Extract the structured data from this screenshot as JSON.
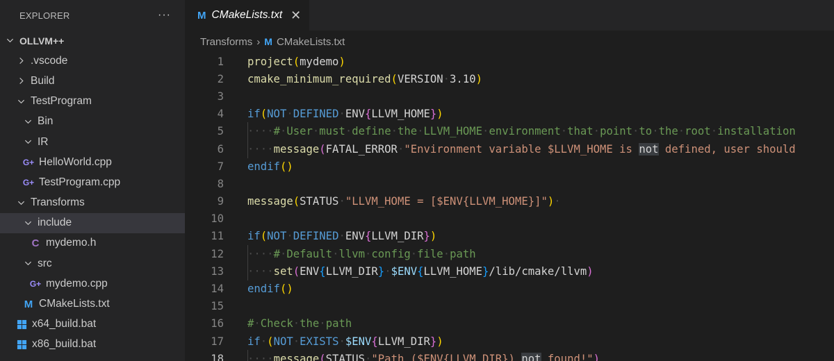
{
  "explorer": {
    "title": "EXPLORER",
    "more_label": "···",
    "tree": [
      {
        "label": "OLLVM++",
        "level": 0,
        "kind": "folder",
        "state": "open",
        "root": true
      },
      {
        "label": ".vscode",
        "level": 1,
        "kind": "folder",
        "state": "closed"
      },
      {
        "label": "Build",
        "level": 1,
        "kind": "folder",
        "state": "closed"
      },
      {
        "label": "TestProgram",
        "level": 1,
        "kind": "folder",
        "state": "open"
      },
      {
        "label": "Bin",
        "level": 2,
        "kind": "folder",
        "state": "open"
      },
      {
        "label": "IR",
        "level": 2,
        "kind": "folder",
        "state": "open"
      },
      {
        "label": "HelloWorld.cpp",
        "level": 2,
        "kind": "cpp"
      },
      {
        "label": "TestProgram.cpp",
        "level": 2,
        "kind": "cpp"
      },
      {
        "label": "Transforms",
        "level": 1,
        "kind": "folder",
        "state": "open"
      },
      {
        "label": "include",
        "level": 2,
        "kind": "folder",
        "state": "open",
        "selected": true
      },
      {
        "label": "mydemo.h",
        "level": 3,
        "kind": "h"
      },
      {
        "label": "src",
        "level": 2,
        "kind": "folder",
        "state": "open"
      },
      {
        "label": "mydemo.cpp",
        "level": 3,
        "kind": "cpp"
      },
      {
        "label": "CMakeLists.txt",
        "level": 2,
        "kind": "cmake"
      },
      {
        "label": "x64_build.bat",
        "level": 1,
        "kind": "bat"
      },
      {
        "label": "x86_build.bat",
        "level": 1,
        "kind": "bat"
      }
    ]
  },
  "tab": {
    "icon_glyph": "M",
    "label": "CMakeLists.txt",
    "close_glyph": "✕"
  },
  "breadcrumb": {
    "folder": "Transforms",
    "separator": "›",
    "icon_glyph": "M",
    "file": "CMakeLists.txt"
  },
  "editor": {
    "current_line": 18,
    "lines": [
      {
        "n": 1,
        "tokens": [
          [
            "fn",
            "project"
          ],
          [
            "p1",
            "("
          ],
          [
            "tx",
            "mydemo"
          ],
          [
            "p1",
            ")"
          ]
        ]
      },
      {
        "n": 2,
        "tokens": [
          [
            "fn",
            "cmake_minimum_required"
          ],
          [
            "p1",
            "("
          ],
          [
            "tx",
            "VERSION"
          ],
          [
            "ws",
            "·"
          ],
          [
            "tx",
            "3.10"
          ],
          [
            "p1",
            ")"
          ]
        ]
      },
      {
        "n": 3,
        "tokens": []
      },
      {
        "n": 4,
        "tokens": [
          [
            "kw",
            "if"
          ],
          [
            "p1",
            "("
          ],
          [
            "kw",
            "NOT"
          ],
          [
            "ws",
            "·"
          ],
          [
            "kw",
            "DEFINED"
          ],
          [
            "ws",
            "·"
          ],
          [
            "tx",
            "ENV"
          ],
          [
            "p2",
            "{"
          ],
          [
            "tx",
            "LLVM_HOME"
          ],
          [
            "p2",
            "}"
          ],
          [
            "p1",
            ")"
          ]
        ]
      },
      {
        "n": 5,
        "guide": true,
        "tokens": [
          [
            "ws",
            "····"
          ],
          [
            "cm",
            "#"
          ],
          [
            "ws",
            "·"
          ],
          [
            "cm",
            "User"
          ],
          [
            "ws",
            "·"
          ],
          [
            "cm",
            "must"
          ],
          [
            "ws",
            "·"
          ],
          [
            "cm",
            "define"
          ],
          [
            "ws",
            "·"
          ],
          [
            "cm",
            "the"
          ],
          [
            "ws",
            "·"
          ],
          [
            "cm",
            "LLVM_HOME"
          ],
          [
            "ws",
            "·"
          ],
          [
            "cm",
            "environment"
          ],
          [
            "ws",
            "·"
          ],
          [
            "cm",
            "that"
          ],
          [
            "ws",
            "·"
          ],
          [
            "cm",
            "point"
          ],
          [
            "ws",
            "·"
          ],
          [
            "cm",
            "to"
          ],
          [
            "ws",
            "·"
          ],
          [
            "cm",
            "the"
          ],
          [
            "ws",
            "·"
          ],
          [
            "cm",
            "root"
          ],
          [
            "ws",
            "·"
          ],
          [
            "cm",
            "installation"
          ]
        ]
      },
      {
        "n": 6,
        "guide": true,
        "tokens": [
          [
            "ws",
            "····"
          ],
          [
            "fn",
            "message"
          ],
          [
            "p2",
            "("
          ],
          [
            "tx",
            "FATAL_ERROR"
          ],
          [
            "ws",
            "·"
          ],
          [
            "str",
            "\"Environment variable $LLVM_HOME is "
          ],
          [
            "hl",
            "not"
          ],
          [
            "str",
            " defined, user should"
          ]
        ]
      },
      {
        "n": 7,
        "tokens": [
          [
            "kw",
            "endif"
          ],
          [
            "p1",
            "()"
          ]
        ]
      },
      {
        "n": 8,
        "tokens": []
      },
      {
        "n": 9,
        "tokens": [
          [
            "fn",
            "message"
          ],
          [
            "p1",
            "("
          ],
          [
            "tx",
            "STATUS"
          ],
          [
            "ws",
            "·"
          ],
          [
            "str",
            "\"LLVM_HOME = [$ENV{LLVM_HOME}]\""
          ],
          [
            "p1",
            ")"
          ],
          [
            "ws",
            "·"
          ]
        ]
      },
      {
        "n": 10,
        "tokens": []
      },
      {
        "n": 11,
        "tokens": [
          [
            "kw",
            "if"
          ],
          [
            "p1",
            "("
          ],
          [
            "kw",
            "NOT"
          ],
          [
            "ws",
            "·"
          ],
          [
            "kw",
            "DEFINED"
          ],
          [
            "ws",
            "·"
          ],
          [
            "tx",
            "ENV"
          ],
          [
            "p2",
            "{"
          ],
          [
            "tx",
            "LLVM_DIR"
          ],
          [
            "p2",
            "}"
          ],
          [
            "p1",
            ")"
          ]
        ]
      },
      {
        "n": 12,
        "guide": true,
        "tokens": [
          [
            "ws",
            "····"
          ],
          [
            "cm",
            "#"
          ],
          [
            "ws",
            "·"
          ],
          [
            "cm",
            "Default"
          ],
          [
            "ws",
            "·"
          ],
          [
            "cm",
            "llvm"
          ],
          [
            "ws",
            "·"
          ],
          [
            "cm",
            "config"
          ],
          [
            "ws",
            "·"
          ],
          [
            "cm",
            "file"
          ],
          [
            "ws",
            "·"
          ],
          [
            "cm",
            "path"
          ]
        ]
      },
      {
        "n": 13,
        "guide": true,
        "tokens": [
          [
            "ws",
            "····"
          ],
          [
            "fn",
            "set"
          ],
          [
            "p2",
            "("
          ],
          [
            "tx",
            "ENV"
          ],
          [
            "p3",
            "{"
          ],
          [
            "tx",
            "LLVM_DIR"
          ],
          [
            "p3",
            "}"
          ],
          [
            "ws",
            "·"
          ],
          [
            "var",
            "$ENV"
          ],
          [
            "p3",
            "{"
          ],
          [
            "tx",
            "LLVM_HOME"
          ],
          [
            "p3",
            "}"
          ],
          [
            "tx",
            "/lib/cmake/llvm"
          ],
          [
            "p2",
            ")"
          ]
        ]
      },
      {
        "n": 14,
        "tokens": [
          [
            "kw",
            "endif"
          ],
          [
            "p1",
            "()"
          ]
        ]
      },
      {
        "n": 15,
        "tokens": []
      },
      {
        "n": 16,
        "tokens": [
          [
            "cm",
            "#"
          ],
          [
            "ws",
            "·"
          ],
          [
            "cm",
            "Check"
          ],
          [
            "ws",
            "·"
          ],
          [
            "cm",
            "the"
          ],
          [
            "ws",
            "·"
          ],
          [
            "cm",
            "path"
          ]
        ]
      },
      {
        "n": 17,
        "tokens": [
          [
            "kw",
            "if"
          ],
          [
            "ws",
            "·"
          ],
          [
            "p1",
            "("
          ],
          [
            "kw",
            "NOT"
          ],
          [
            "ws",
            "·"
          ],
          [
            "kw",
            "EXISTS"
          ],
          [
            "ws",
            "·"
          ],
          [
            "var",
            "$ENV"
          ],
          [
            "p2",
            "{"
          ],
          [
            "tx",
            "LLVM_DIR"
          ],
          [
            "p2",
            "}"
          ],
          [
            "p1",
            ")"
          ]
        ]
      },
      {
        "n": 18,
        "guide": true,
        "tokens": [
          [
            "ws",
            "····"
          ],
          [
            "fn",
            "message"
          ],
          [
            "p2",
            "("
          ],
          [
            "tx",
            "STATUS"
          ],
          [
            "ws",
            "·"
          ],
          [
            "str",
            "\"Path ($ENV{LLVM_DIR}) "
          ],
          [
            "hl",
            "not"
          ],
          [
            "str",
            " found!\""
          ],
          [
            "p2",
            ")"
          ]
        ]
      }
    ]
  },
  "colors": {
    "sidebar_bg": "#252526",
    "editor_bg": "#1e1e1e",
    "selected_row": "#37373d",
    "cmake_icon": "#42a5f5",
    "cpp_icon": "#9b8dfb",
    "header_icon": "#a074c4"
  },
  "icons": {
    "folder_open": "chevron-down-icon",
    "folder_closed": "chevron-right-icon",
    "cpp": "cpp-file-icon",
    "h": "c-header-file-icon",
    "cmake": "cmake-file-icon",
    "bat": "windows-bat-file-icon",
    "more": "more-actions-icon",
    "close": "close-icon"
  }
}
